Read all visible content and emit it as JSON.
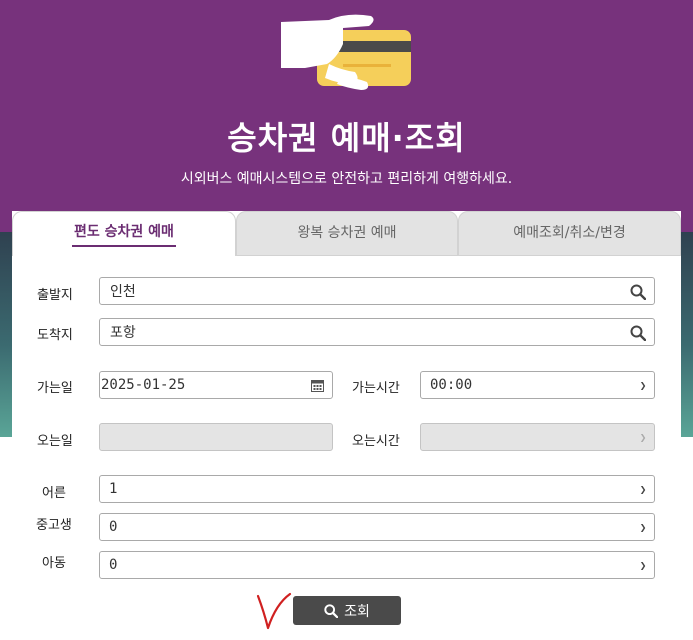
{
  "hero": {
    "title": "승차권 예매·조회",
    "subtitle": "시외버스 예매시스템으로 안전하고 편리하게 여행하세요."
  },
  "tabs": [
    {
      "label": "편도 승차권 예매",
      "active": true
    },
    {
      "label": "왕복 승차권 예매",
      "active": false
    },
    {
      "label": "예매조회/취소/변경",
      "active": false
    }
  ],
  "form": {
    "departure": {
      "label": "출발지",
      "value": "인천"
    },
    "arrival": {
      "label": "도착지",
      "value": "포항"
    },
    "go_date": {
      "label": "가는일",
      "value": "2025-01-25"
    },
    "go_time": {
      "label": "가는시간",
      "value": "00:00"
    },
    "return_date": {
      "label": "오는일",
      "value": ""
    },
    "return_time": {
      "label": "오는시간",
      "value": ""
    },
    "adult": {
      "label": "어른",
      "value": "1"
    },
    "teen": {
      "label": "중고생",
      "value": "0"
    },
    "child": {
      "label": "아동",
      "value": "0"
    }
  },
  "search_button": {
    "label": "조회",
    "icon": "search-icon"
  },
  "colors": {
    "hero": "#77327c",
    "active_tab_text": "#6b2d72",
    "button": "#4a4a4a",
    "annotation": "#d02020"
  }
}
